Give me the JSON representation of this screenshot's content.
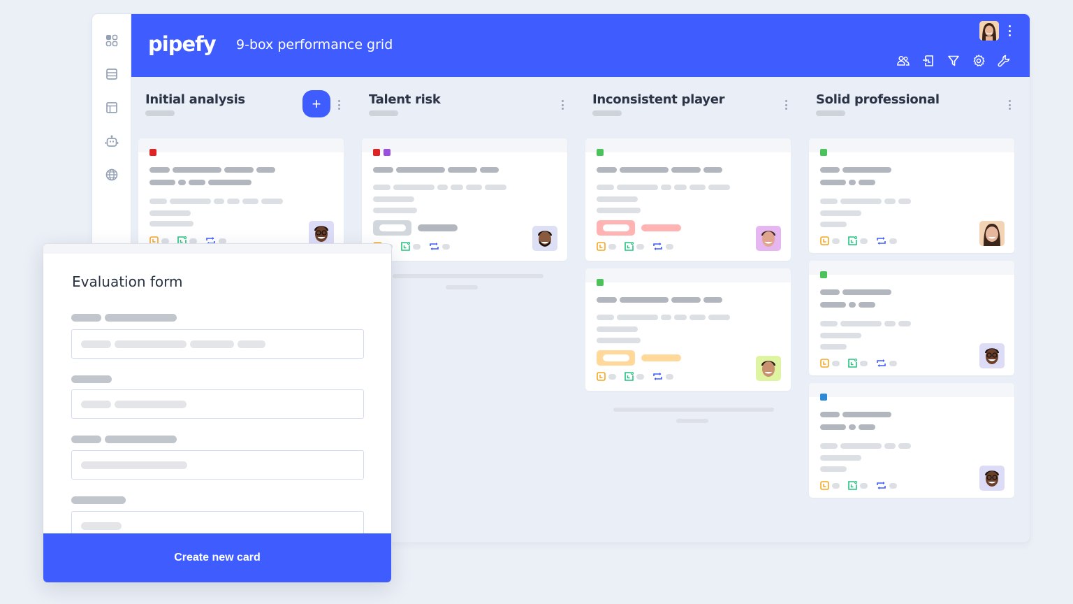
{
  "app": {
    "logo": "pipefy",
    "title": "9-box performance grid"
  },
  "sidebar": {
    "items": [
      {
        "icon": "apps-grid-icon"
      },
      {
        "icon": "database-icon"
      },
      {
        "icon": "layout-icon"
      },
      {
        "icon": "robot-icon"
      },
      {
        "icon": "globe-icon"
      }
    ]
  },
  "header_tools": [
    {
      "icon": "members-icon"
    },
    {
      "icon": "import-icon"
    },
    {
      "icon": "filter-icon"
    },
    {
      "icon": "settings-icon"
    },
    {
      "icon": "wrench-icon"
    }
  ],
  "colors": {
    "accent": "#3f5cff",
    "tag_red": "#e02424",
    "tag_purple": "#9b51e0",
    "tag_green": "#4cc35a",
    "tag_blue": "#2d8ad9",
    "pill_red": "#ffb3b3",
    "pill_orange": "#ffd89a",
    "icon_orange": "#f5a623",
    "icon_green": "#27c281",
    "icon_blue": "#3f5cff"
  },
  "columns": [
    {
      "title": "Initial analysis",
      "has_add_button": true,
      "add_label": "+"
    },
    {
      "title": "Talent risk"
    },
    {
      "title": "Inconsistent player"
    },
    {
      "title": "Solid professional"
    }
  ],
  "form": {
    "title": "Evaluation form",
    "fields": 4,
    "submit_label": "Create new card"
  }
}
